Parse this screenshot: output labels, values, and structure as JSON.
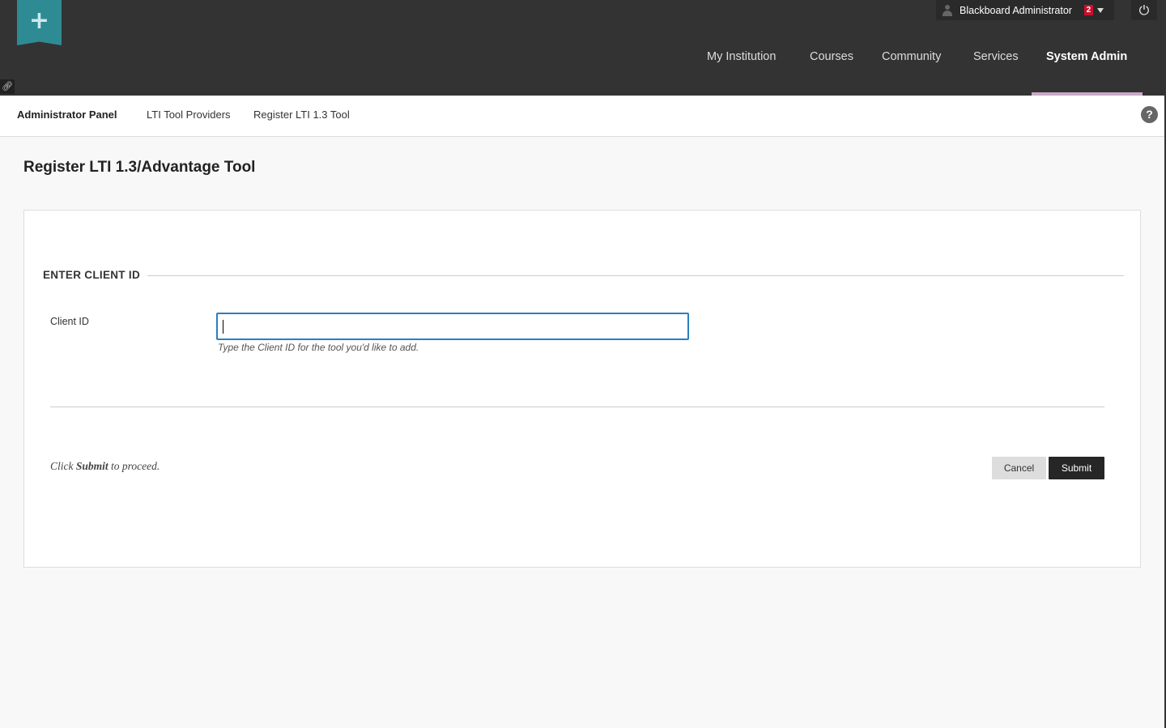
{
  "header": {
    "logo_icon": "plus-icon",
    "user": {
      "name": "Blackboard Administrator",
      "notification_count": "2"
    },
    "nav": [
      "My Institution",
      "Courses",
      "Community",
      "Services",
      "System Admin"
    ],
    "active_nav": "System Admin"
  },
  "breadcrumb": [
    "Administrator Panel",
    "LTI Tool Providers",
    "Register LTI 1.3 Tool"
  ],
  "page": {
    "title": "Register LTI 1.3/Advantage Tool"
  },
  "form": {
    "section_title": "ENTER CLIENT ID",
    "client_id_label": "Client ID",
    "client_id_value": "",
    "client_id_hint": "Type the Client ID for the tool you'd like to add.",
    "footer_prefix": "Click ",
    "footer_bold": "Submit",
    "footer_suffix": " to proceed.",
    "cancel_label": "Cancel",
    "submit_label": "Submit"
  },
  "colors": {
    "header_bg": "#333333",
    "logo_teal": "#2e8b94",
    "active_underline": "#c9a9c6",
    "badge_red": "#c8102e",
    "input_focus": "#2a7fc0"
  }
}
